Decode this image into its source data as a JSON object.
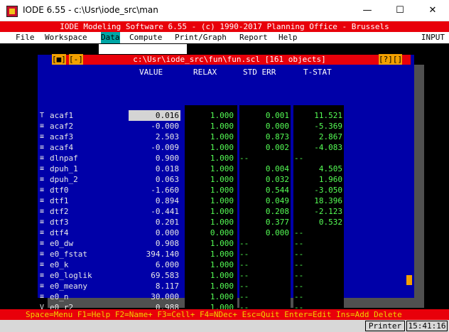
{
  "window": {
    "title": "IODE 6.55 - c:\\Usr\\iode_src\\man",
    "minimize_glyph": "—",
    "maximize_glyph": "☐",
    "close_glyph": "✕"
  },
  "banner": "IODE Modeling Software 6.55 - (c) 1990-2017 Planning Office - Brussels",
  "menu": {
    "items": [
      "File",
      "Workspace",
      "Data",
      "Compute",
      "Print/Graph",
      "Report",
      "Help"
    ],
    "active": "Data",
    "right": "INPUT"
  },
  "panel": {
    "close_btn": "[■]",
    "min_btn": "[-]",
    "help_btn": "[?][]",
    "title": "c:\\Usr\\iode_src\\fun\\fun.scl [161 objects]",
    "headers": {
      "value": "VALUE",
      "relax": "RELAX",
      "stderr": "STD ERR",
      "tstat": "T-STAT"
    },
    "indicators": [
      "T",
      "≡",
      "≡",
      "≡",
      "≡",
      "≡",
      "≡",
      "≡",
      "≡",
      "≡",
      "≡",
      "≡",
      "≡",
      "≡",
      "≡",
      "≡",
      "≡",
      "≡",
      "V"
    ],
    "rows": [
      {
        "name": "acaf1",
        "value": "0.016",
        "relax": "1.000",
        "stderr": "0.001",
        "tstat": "11.521"
      },
      {
        "name": "acaf2",
        "value": "-0.000",
        "relax": "1.000",
        "stderr": "0.000",
        "tstat": "-5.369"
      },
      {
        "name": "acaf3",
        "value": "2.503",
        "relax": "1.000",
        "stderr": "0.873",
        "tstat": "2.867"
      },
      {
        "name": "acaf4",
        "value": "-0.009",
        "relax": "1.000",
        "stderr": "0.002",
        "tstat": "-4.083"
      },
      {
        "name": "dlnpaf",
        "value": "0.900",
        "relax": "1.000",
        "stderr": "--",
        "tstat": "--"
      },
      {
        "name": "dpuh_1",
        "value": "0.018",
        "relax": "1.000",
        "stderr": "0.004",
        "tstat": "4.505"
      },
      {
        "name": "dpuh_2",
        "value": "0.063",
        "relax": "1.000",
        "stderr": "0.032",
        "tstat": "1.960"
      },
      {
        "name": "dtf0",
        "value": "-1.660",
        "relax": "1.000",
        "stderr": "0.544",
        "tstat": "-3.050"
      },
      {
        "name": "dtf1",
        "value": "0.894",
        "relax": "1.000",
        "stderr": "0.049",
        "tstat": "18.396"
      },
      {
        "name": "dtf2",
        "value": "-0.441",
        "relax": "1.000",
        "stderr": "0.208",
        "tstat": "-2.123"
      },
      {
        "name": "dtf3",
        "value": "0.201",
        "relax": "1.000",
        "stderr": "0.377",
        "tstat": "0.532"
      },
      {
        "name": "dtf4",
        "value": "0.000",
        "relax": "0.000",
        "stderr": "0.000",
        "tstat": "--"
      },
      {
        "name": "e0_dw",
        "value": "0.908",
        "relax": "1.000",
        "stderr": "--",
        "tstat": "--"
      },
      {
        "name": "e0_fstat",
        "value": "394.140",
        "relax": "1.000",
        "stderr": "--",
        "tstat": "--"
      },
      {
        "name": "e0_k",
        "value": "6.000",
        "relax": "1.000",
        "stderr": "--",
        "tstat": "--"
      },
      {
        "name": "e0_loglik",
        "value": "69.583",
        "relax": "1.000",
        "stderr": "--",
        "tstat": "--"
      },
      {
        "name": "e0_meany",
        "value": "8.117",
        "relax": "1.000",
        "stderr": "--",
        "tstat": "--"
      },
      {
        "name": "e0_n",
        "value": "30.000",
        "relax": "1.000",
        "stderr": "--",
        "tstat": "--"
      },
      {
        "name": "e0_r2",
        "value": "0.988",
        "relax": "1.000",
        "stderr": "--",
        "tstat": "--"
      }
    ]
  },
  "statusbar": "Space=Menu F1=Help F2=Name+ F3=Cell+ F4=NDec+ Esc=Quit Enter=Edit Ins=Add Delete",
  "bottombar": {
    "printer": "Printer",
    "clock": "15:41:16"
  },
  "colors": {
    "banner_red": "#e8000a",
    "panel_blue": "#0000a8",
    "value_green": "#55ff55",
    "menu_active": "#00a6a6",
    "status_yellow": "#f2d000"
  }
}
